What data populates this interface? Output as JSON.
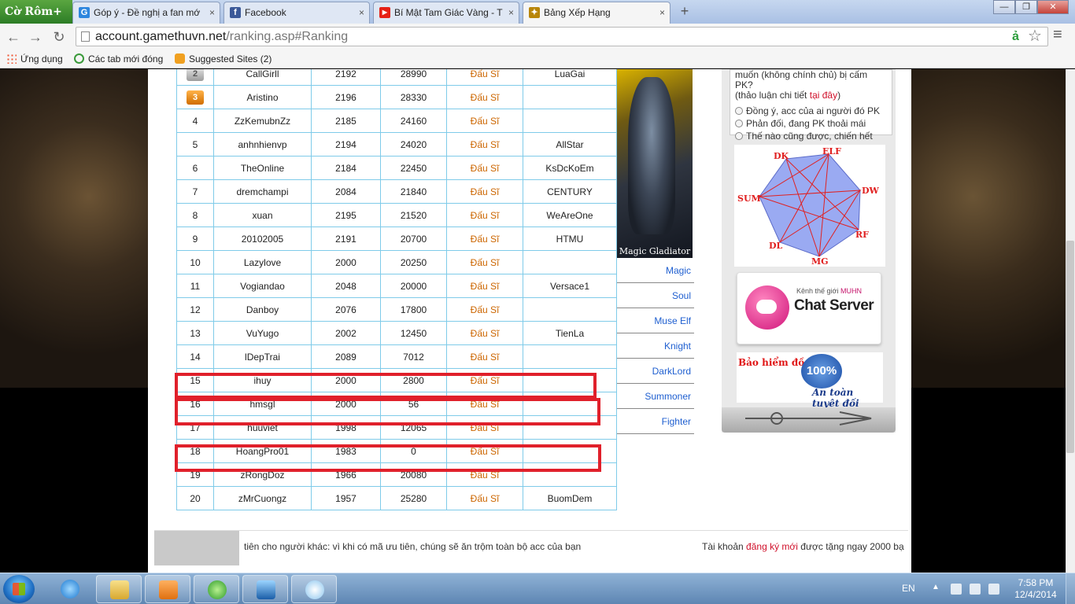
{
  "browser": {
    "brand": "Cờ Rôm+",
    "tabs": [
      {
        "title": "Góp ý - Đề nghị a fan mớ",
        "icon_color": "#2e86de",
        "icon_letter": "G"
      },
      {
        "title": "Facebook",
        "icon_color": "#3b5998",
        "icon_letter": "f"
      },
      {
        "title": "Bí Mật Tam Giác Vàng - T",
        "icon_color": "#e62117",
        "icon_letter": "▶"
      },
      {
        "title": "Bảng Xếp Hạng",
        "icon_color": "#b8860b",
        "icon_letter": "✦"
      }
    ],
    "tab_close": "×",
    "new_tab": "+",
    "window_buttons": [
      "—",
      "❐",
      "✕"
    ],
    "nav": {
      "back": "←",
      "forward": "→",
      "reload": "↻"
    },
    "url_host": "account.gamethuvn.net",
    "url_path": "/ranking.asp#Ranking",
    "omni_icons": {
      "translate": "ả",
      "star": "☆",
      "menu": "≡"
    },
    "bookmarks": [
      {
        "label": "Ứng dụng",
        "icon": "apps-grid-icon"
      },
      {
        "label": "Các tab mới đóng",
        "icon": "recent-tabs-icon"
      },
      {
        "label": "Suggested Sites (2)",
        "icon": "suggested-sites-icon"
      }
    ]
  },
  "ranking": {
    "rows": [
      {
        "rank": "2",
        "medal": "silver",
        "name": "CallGirll",
        "level": "2192",
        "points": "28990",
        "class": "Đấu Sĩ",
        "guild": "LuaGai"
      },
      {
        "rank": "3",
        "medal": "bronze",
        "name": "Aristino",
        "level": "2196",
        "points": "28330",
        "class": "Đấu Sĩ",
        "guild": ""
      },
      {
        "rank": "4",
        "name": "ZzKemubnZz",
        "level": "2185",
        "points": "24160",
        "class": "Đấu Sĩ",
        "guild": ""
      },
      {
        "rank": "5",
        "name": "anhnhienvp",
        "level": "2194",
        "points": "24020",
        "class": "Đấu Sĩ",
        "guild": "AllStar"
      },
      {
        "rank": "6",
        "name": "TheOnline",
        "level": "2184",
        "points": "22450",
        "class": "Đấu Sĩ",
        "guild": "KsDcKoEm"
      },
      {
        "rank": "7",
        "name": "dremchampi",
        "level": "2084",
        "points": "21840",
        "class": "Đấu Sĩ",
        "guild": "CENTURY"
      },
      {
        "rank": "8",
        "name": "xuan",
        "level": "2195",
        "points": "21520",
        "class": "Đấu Sĩ",
        "guild": "WeAreOne"
      },
      {
        "rank": "9",
        "name": "20102005",
        "level": "2191",
        "points": "20700",
        "class": "Đấu Sĩ",
        "guild": "HTMU"
      },
      {
        "rank": "10",
        "name": "Lazylove",
        "level": "2000",
        "points": "20250",
        "class": "Đấu Sĩ",
        "guild": ""
      },
      {
        "rank": "11",
        "name": "Vogiandao",
        "level": "2048",
        "points": "20000",
        "class": "Đấu Sĩ",
        "guild": "Versace1"
      },
      {
        "rank": "12",
        "name": "Danboy",
        "level": "2076",
        "points": "17800",
        "class": "Đấu Sĩ",
        "guild": ""
      },
      {
        "rank": "13",
        "name": "VuYugo",
        "level": "2002",
        "points": "12450",
        "class": "Đấu Sĩ",
        "guild": "TienLa"
      },
      {
        "rank": "14",
        "name": "lDepTrai",
        "level": "2089",
        "points": "7012",
        "class": "Đấu Sĩ",
        "guild": ""
      },
      {
        "rank": "15",
        "name": "ihuy",
        "level": "2000",
        "points": "2800",
        "class": "Đấu Sĩ",
        "guild": ""
      },
      {
        "rank": "16",
        "name": "hmsgl",
        "level": "2000",
        "points": "56",
        "class": "Đấu Sĩ",
        "guild": ""
      },
      {
        "rank": "17",
        "name": "huuviet",
        "level": "1998",
        "points": "12065",
        "class": "Đấu Sĩ",
        "guild": ""
      },
      {
        "rank": "18",
        "name": "HoangPro01",
        "level": "1983",
        "points": "0",
        "class": "Đấu Sĩ",
        "guild": ""
      },
      {
        "rank": "19",
        "name": "zRongDoz",
        "level": "1966",
        "points": "20080",
        "class": "Đấu Sĩ",
        "guild": ""
      },
      {
        "rank": "20",
        "name": "zMrCuongz",
        "level": "1957",
        "points": "25280",
        "class": "Đấu Sĩ",
        "guild": "BuomDem"
      }
    ],
    "highlight_color": "#e0202b"
  },
  "character": {
    "caption": "Magic Gladiator",
    "classes": [
      "Magic",
      "Soul",
      "Muse Elf",
      "Knight",
      "DarkLord",
      "Summoner",
      "Fighter"
    ]
  },
  "poll": {
    "line1": "muốn (không chính chủ) bị cấm PK?",
    "line2_prefix": "(thảo luận chi tiết ",
    "line2_link": "tại đây",
    "line2_suffix": ")",
    "options": [
      "Đồng ý, acc của ai người đó PK",
      "Phản đối, đang PK thoải mái",
      "Thế nào cũng được, chiến hết"
    ]
  },
  "diagram": {
    "labels": [
      "DK",
      "ELF",
      "DW",
      "RF",
      "MG",
      "DL",
      "SUM"
    ]
  },
  "chat": {
    "kenh_prefix": "Kênh thế giới ",
    "kenh_brand": "MUHN",
    "title": "Chat Server"
  },
  "insurance": {
    "title": "Bảo hiểm đồ",
    "seal": "100%",
    "subtitle": "An toàn tuyệt đối"
  },
  "footer": {
    "marquee1": "tiên cho người khác: vì khi có mã ưu tiên, chúng sẽ ăn trộm toàn bộ acc của bạn",
    "marquee2_prefix": "Tài khoản ",
    "marquee2_link": "đăng ký mới",
    "marquee2_suffix": " được tặng ngay 2000 bạ"
  },
  "taskbar": {
    "language": "EN",
    "time": "7:58 PM",
    "date": "12/4/2014",
    "tray_up": "▲"
  }
}
